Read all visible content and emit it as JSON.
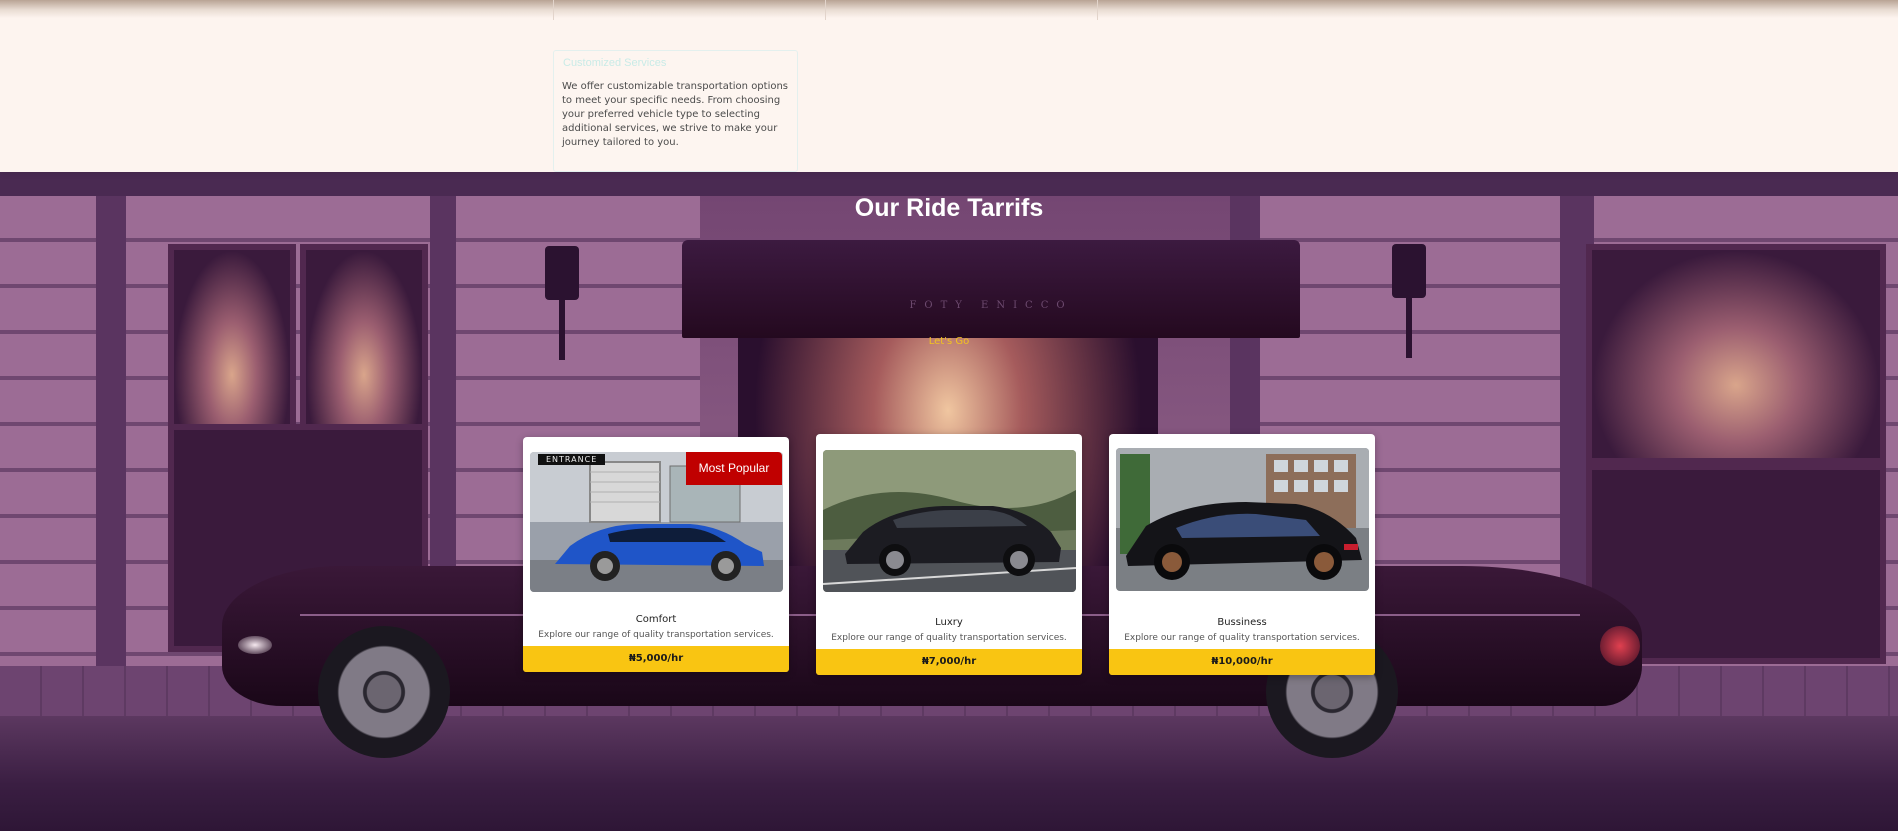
{
  "features": {
    "card_title": "Customized Services",
    "card_text": "We offer customizable transportation options to meet your specific needs. From choosing your preferred vehicle type to selecting additional services, we strive to make your journey tailored to you."
  },
  "tariffs": {
    "title": "Our Ride Tarrifs",
    "cta": "Let's Go",
    "badge": "Most Popular",
    "entrance_sign": "ENTRANCE",
    "awning_text": "FOTY ENICCO",
    "cards": [
      {
        "name": "Comfort",
        "description": "Explore our range of quality transportation services.",
        "price": "₦5,000/hr",
        "car_color": "#1f55c8"
      },
      {
        "name": "Luxry",
        "description": "Explore our range of quality transportation services.",
        "price": "₦7,000/hr",
        "car_color": "#1c1c22"
      },
      {
        "name": "Bussiness",
        "description": "Explore our range of quality transportation services.",
        "price": "₦10,000/hr",
        "car_color": "#141418"
      }
    ]
  },
  "colors": {
    "accent_yellow": "#f9c512",
    "badge_red": "#c00000",
    "section_bg": "#8d5f86"
  }
}
